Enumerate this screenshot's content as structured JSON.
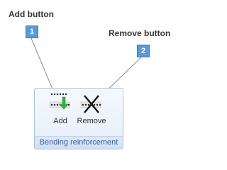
{
  "callouts": [
    {
      "number": "1",
      "label": "Add button"
    },
    {
      "number": "2",
      "label": "Remove button"
    }
  ],
  "ribbon_group": {
    "caption": "Bending reinforcement",
    "buttons": [
      {
        "label": "Add",
        "icon": "add-bending-reinforcement-icon"
      },
      {
        "label": "Remove",
        "icon": "remove-bending-reinforcement-icon"
      }
    ]
  },
  "colors": {
    "badge": "#5a9ad6",
    "leader_line": "#8c8c8c",
    "add_arrow": "#3cb043",
    "group_border": "#a8c3e0",
    "caption_text": "#3a63a0"
  }
}
